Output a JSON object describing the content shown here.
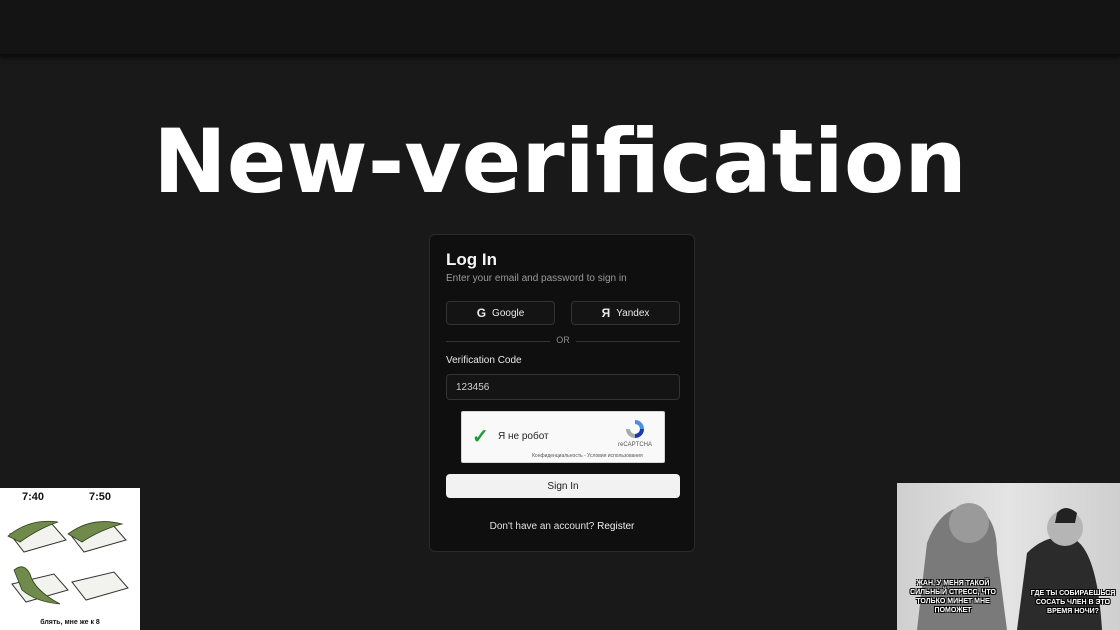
{
  "headline": "New-verification",
  "login": {
    "title": "Log In",
    "subtitle": "Enter your email and password to sign in",
    "google_label": "Google",
    "yandex_label": "Yandex",
    "divider": "OR",
    "code_label": "Verification Code",
    "code_value": "123456",
    "captcha_text": "Я не робот",
    "captcha_brand": "reCAPTCHA",
    "captcha_legal": "Конфиденциальность - Условия использования",
    "signin_label": "Sign In",
    "register_prompt": "Don't have an account?",
    "register_link": "Register"
  },
  "memes": {
    "left": {
      "time1": "7:40",
      "time2": "7:50",
      "caption": "блять, мне же к 8"
    },
    "right": {
      "caption_left": "ЖАН, У МЕНЯ ТАКОЙ СИЛЬНЫЙ СТРЕСС, ЧТО ТОЛЬКО МИНЕТ МНЕ ПОМОЖЕТ",
      "caption_right": "ГДЕ ТЫ СОБИРАЕШЬСЯ СОСАТЬ ЧЛЕН В ЭТО ВРЕМЯ НОЧИ?"
    }
  },
  "colors": {
    "background": "#191919",
    "card": "#0f0f0f",
    "captcha_check": "#1a9e3a"
  }
}
